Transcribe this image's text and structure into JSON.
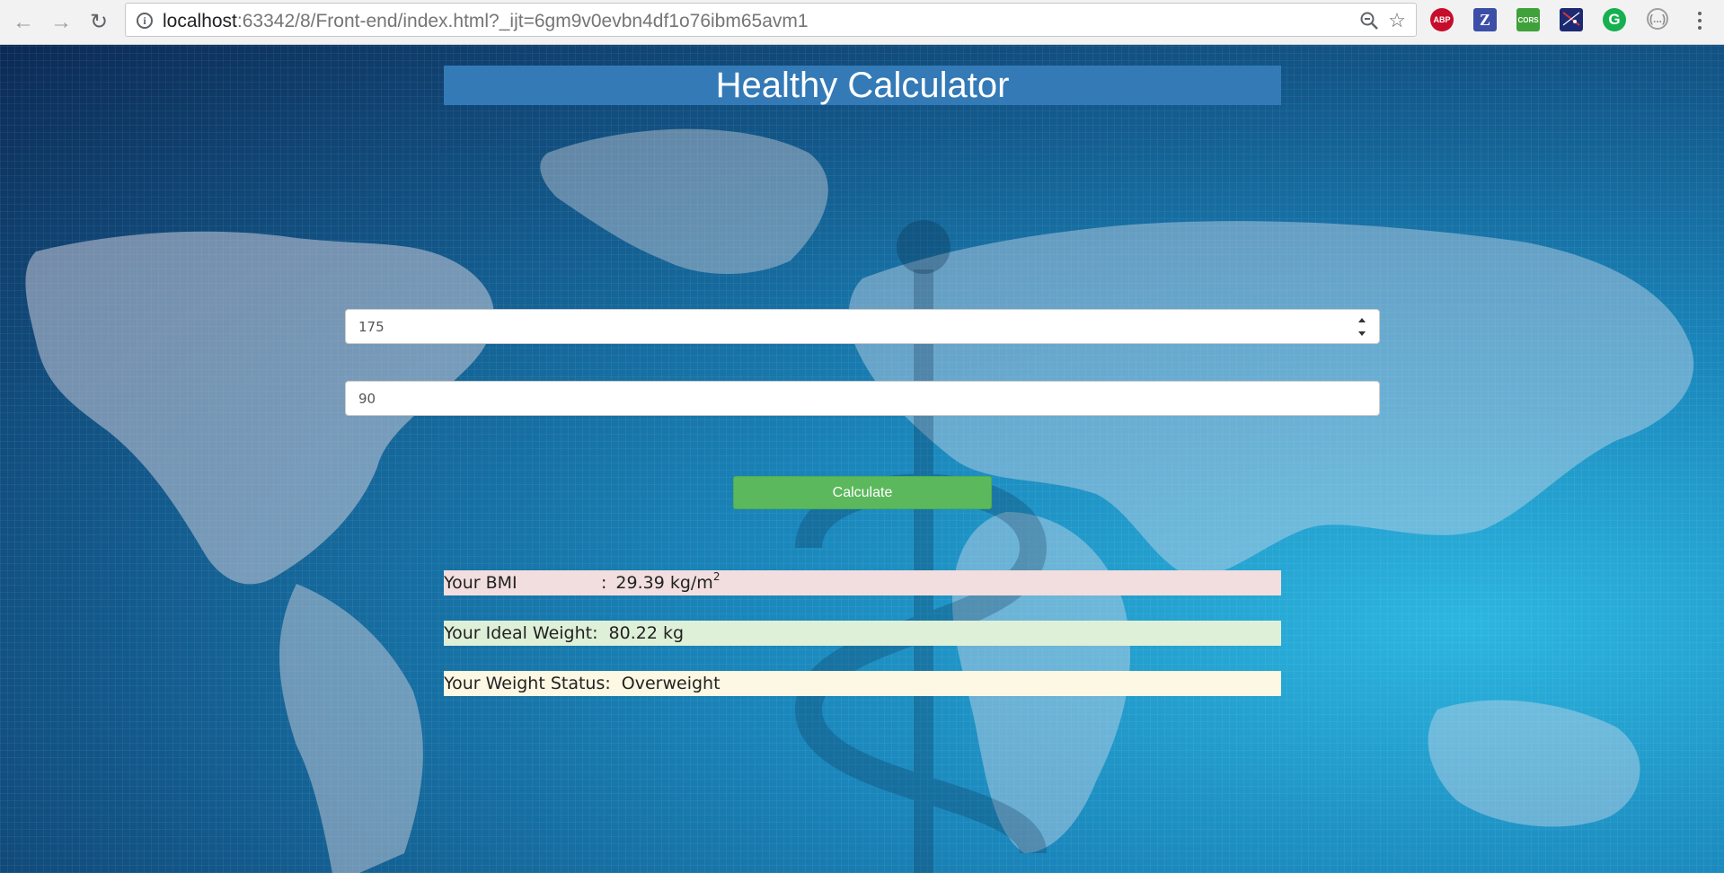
{
  "browser": {
    "url_host": "localhost",
    "url_rest": ":63342/8/Front-end/index.html?_ijt=6gm9v0evbn4df1o76ibm65avm1",
    "extensions": [
      "ABP",
      "Z",
      "CORS",
      "flag-extension",
      "G",
      "(...)"
    ]
  },
  "page": {
    "title": "Healthy Calculator",
    "height_value": "175",
    "weight_value": "90",
    "calculate_label": "Calculate",
    "results": {
      "bmi_label": "Your BMI",
      "bmi_separator": ":",
      "bmi_value": "29.39 kg/m",
      "bmi_exponent": "2",
      "ideal_label": "Your Ideal Weight:",
      "ideal_value": "80.22 kg",
      "status_label": "Your Weight Status:",
      "status_value": "Overweight"
    }
  },
  "colors": {
    "title_bg": "#337ab7",
    "button_bg": "#5cb85c",
    "bmi_bg": "#f2dede",
    "ideal_bg": "#dff0d8",
    "status_bg": "#fcf8e3"
  },
  "icons": [
    "back-arrow-icon",
    "forward-arrow-icon",
    "reload-icon",
    "info-icon",
    "zoom-icon",
    "star-icon",
    "menu-icon"
  ]
}
